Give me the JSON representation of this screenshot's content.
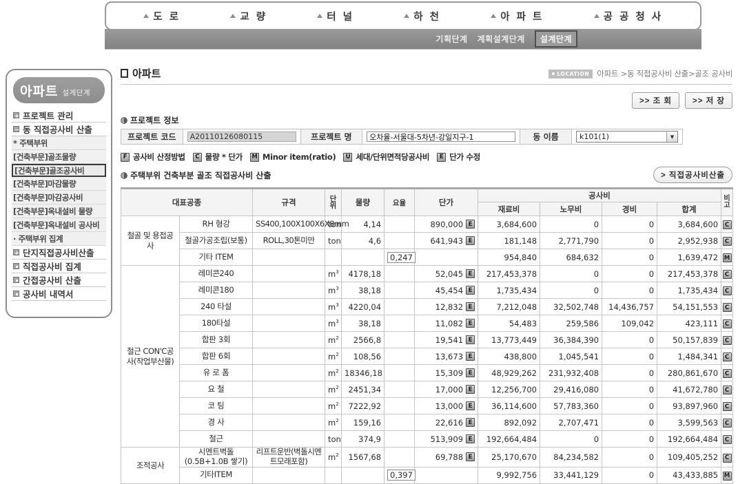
{
  "nav": {
    "items": [
      {
        "label": "도 로"
      },
      {
        "label": "교 량"
      },
      {
        "label": "터 널"
      },
      {
        "label": "하 천"
      },
      {
        "label": "아 파 트"
      },
      {
        "label": "공 공 청 사"
      }
    ]
  },
  "stages": [
    {
      "label": "기획단계",
      "selected": false
    },
    {
      "label": "계획설계단계",
      "selected": false
    },
    {
      "label": "설계단계",
      "selected": true
    }
  ],
  "sidebar": {
    "title_big": "아파트",
    "title_small": "설계단계",
    "items": [
      {
        "label": "프로젝트 관리",
        "type": "plus"
      },
      {
        "label": "동 직접공사비 산출",
        "type": "minus"
      },
      {
        "label": "* 주택부위",
        "type": "sub"
      },
      {
        "label": "[건축부문]골조물량",
        "type": "sub"
      },
      {
        "label": "[건축부문]골조공사비",
        "type": "sub",
        "selected": true
      },
      {
        "label": "[건축부문]마감물량",
        "type": "sub"
      },
      {
        "label": "[건축부문]마감공사비",
        "type": "sub"
      },
      {
        "label": "[건축부문]옥내설비 물량",
        "type": "sub"
      },
      {
        "label": "[건축부문]옥내설비 공사비",
        "type": "sub"
      },
      {
        "label": "· 주택부위 집계",
        "type": "sub"
      },
      {
        "label": "단지직접공사비산출",
        "type": "plus"
      },
      {
        "label": "직접공사비 집계",
        "type": "dot"
      },
      {
        "label": "간접공사비 산출",
        "type": "dot"
      },
      {
        "label": "공사비 내역서",
        "type": "dot"
      }
    ]
  },
  "header": {
    "title": "아파트",
    "location_chip": "LOCATION",
    "breadcrumb": "아파트 >동 직접공사비 산출>골조 공사비",
    "search_button": ">> 조 회",
    "save_button": ">> 저 장"
  },
  "project": {
    "section_title": "프로젝트 정보",
    "code_label": "프로젝트 코드",
    "code_value": "A20110126080115",
    "name_label": "프로젝트 명",
    "name_value": "오차율-서울대-5차년-강일지구-1",
    "dong_label": "동 이름",
    "dong_value": "k101(1)"
  },
  "legend": {
    "method_label": "공사비 산정방법",
    "method_badge": "F",
    "items": [
      {
        "badge": "C",
        "label": "물량 * 단가"
      },
      {
        "badge": "M",
        "label": "Minor item(ratio)"
      },
      {
        "badge": "U",
        "label": "세대/단위면적당공사비"
      },
      {
        "badge": "E",
        "label": "단가 수정"
      }
    ]
  },
  "section2": {
    "title": "주택부위 건축부분 골조 직접공사비 산출",
    "calc_button": "> 직접공사비산출"
  },
  "table": {
    "headers": {
      "work": "대표공종",
      "spec": "규격",
      "unit": "단위",
      "qty": "물량",
      "rate": "요율",
      "price": "단가",
      "cost": "공사비",
      "material": "재료비",
      "labor": "노무비",
      "expense": "경비",
      "total": "합계",
      "note": "비고"
    },
    "groups": [
      {
        "name": "철골 및 용접공사",
        "rows": [
          {
            "name": "RH 형강",
            "spec": "SS400,100X100X6X8mm",
            "unit": "ton",
            "qty": "4,14",
            "rate": "",
            "price": "890,000",
            "price_badge": "E",
            "material": "3,684,600",
            "labor": "0",
            "expense": "0",
            "total": "3,684,600",
            "note": "C"
          },
          {
            "name": "철골가공조립(보통)",
            "spec": "ROLL,30톤미만",
            "unit": "ton",
            "qty": "4,6",
            "rate": "",
            "price": "641,943",
            "price_badge": "E",
            "material": "181,148",
            "labor": "2,771,790",
            "expense": "0",
            "total": "2,952,938",
            "note": "C"
          },
          {
            "name": "기타 ITEM",
            "spec": "",
            "unit": "",
            "qty": "",
            "rate": "0,247",
            "price": "",
            "price_badge": "",
            "material": "954,840",
            "labor": "684,632",
            "expense": "0",
            "total": "1,639,472",
            "note": "M"
          }
        ]
      },
      {
        "name": "철근 CON'C공사(작업부산물)",
        "rows": [
          {
            "name": "레미콘240",
            "spec": "",
            "unit": "m3",
            "qty": "4178,18",
            "rate": "",
            "price": "52,045",
            "price_badge": "E",
            "material": "217,453,378",
            "labor": "0",
            "expense": "0",
            "total": "217,453,378",
            "note": "C"
          },
          {
            "name": "레미콘180",
            "spec": "",
            "unit": "m3",
            "qty": "38,18",
            "rate": "",
            "price": "45,454",
            "price_badge": "E",
            "material": "1,735,434",
            "labor": "0",
            "expense": "0",
            "total": "1,735,434",
            "note": "C"
          },
          {
            "name": "240 타설",
            "spec": "",
            "unit": "m3",
            "qty": "4220,04",
            "rate": "",
            "price": "12,832",
            "price_badge": "E",
            "material": "7,212,048",
            "labor": "32,502,748",
            "expense": "14,436,757",
            "total": "54,151,553",
            "note": "C"
          },
          {
            "name": "180타설",
            "spec": "",
            "unit": "m3",
            "qty": "38,18",
            "rate": "",
            "price": "11,082",
            "price_badge": "E",
            "material": "54,483",
            "labor": "259,586",
            "expense": "109,042",
            "total": "423,111",
            "note": "C"
          },
          {
            "name": "합판 3회",
            "spec": "",
            "unit": "m2",
            "qty": "2566,8",
            "rate": "",
            "price": "19,541",
            "price_badge": "E",
            "material": "13,773,449",
            "labor": "36,384,390",
            "expense": "0",
            "total": "50,157,839",
            "note": "C"
          },
          {
            "name": "합판 6회",
            "spec": "",
            "unit": "m2",
            "qty": "108,56",
            "rate": "",
            "price": "13,673",
            "price_badge": "E",
            "material": "438,800",
            "labor": "1,045,541",
            "expense": "0",
            "total": "1,484,341",
            "note": "C"
          },
          {
            "name": "유 로 폼",
            "spec": "",
            "unit": "m2",
            "qty": "18346,18",
            "rate": "",
            "price": "15,309",
            "price_badge": "E",
            "material": "48,929,262",
            "labor": "231,932,408",
            "expense": "0",
            "total": "280,861,670",
            "note": "C"
          },
          {
            "name": "요 철",
            "spec": "",
            "unit": "m2",
            "qty": "2451,34",
            "rate": "",
            "price": "17,000",
            "price_badge": "E",
            "material": "12,256,700",
            "labor": "29,416,080",
            "expense": "0",
            "total": "41,672,780",
            "note": "C"
          },
          {
            "name": "코 팅",
            "spec": "",
            "unit": "m2",
            "qty": "7222,92",
            "rate": "",
            "price": "13,000",
            "price_badge": "E",
            "material": "36,114,600",
            "labor": "57,783,360",
            "expense": "0",
            "total": "93,897,960",
            "note": "C"
          },
          {
            "name": "경 사",
            "spec": "",
            "unit": "m2",
            "qty": "159,16",
            "rate": "",
            "price": "22,616",
            "price_badge": "E",
            "material": "892,092",
            "labor": "2,707,471",
            "expense": "0",
            "total": "3,599,563",
            "note": "C"
          },
          {
            "name": "철근",
            "spec": "",
            "unit": "ton",
            "qty": "374,9",
            "rate": "",
            "price": "513,909",
            "price_badge": "E",
            "material": "192,664,484",
            "labor": "0",
            "expense": "0",
            "total": "192,664,484",
            "note": "C"
          }
        ]
      },
      {
        "name": "조적공사",
        "rows": [
          {
            "name": "시멘트벽돌(0.5B+1.0B 쌓기)",
            "spec": "리프트운반(벽돌시멘트모래포함)",
            "unit": "m2",
            "qty": "1567,68",
            "rate": "",
            "price": "69,788",
            "price_badge": "E",
            "material": "25,170,670",
            "labor": "84,234,582",
            "expense": "0",
            "total": "109,405,252",
            "note": "C"
          },
          {
            "name": "기타ITEM",
            "spec": "",
            "unit": "",
            "qty": "",
            "rate": "0,397",
            "price": "",
            "price_badge": "",
            "material": "9,992,756",
            "labor": "33,441,129",
            "expense": "0",
            "total": "43,433,885",
            "note": "M"
          }
        ]
      }
    ]
  }
}
